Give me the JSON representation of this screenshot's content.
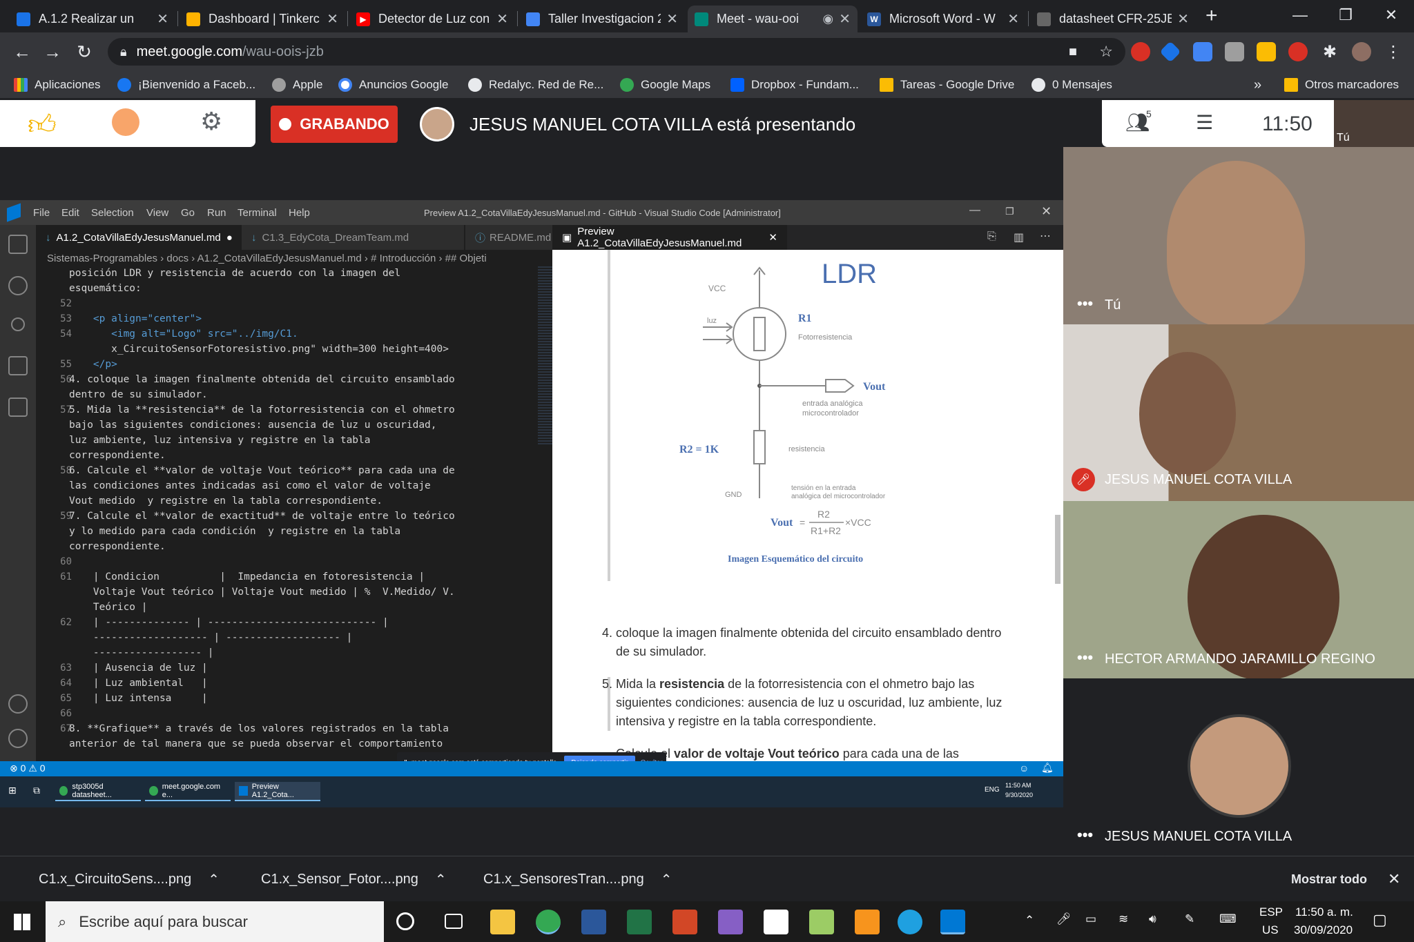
{
  "chrome": {
    "tabs": [
      {
        "title": "A.1.2 Realizar un",
        "icon": "moodle-icon",
        "color": "#1a73e8"
      },
      {
        "title": "Dashboard | Tinkerc",
        "icon": "tinkercad-icon",
        "color": "#ffb300"
      },
      {
        "title": "Detector de Luz con",
        "icon": "youtube-icon",
        "color": "#ff0000"
      },
      {
        "title": "Taller Investigacion 2",
        "icon": "docs-icon",
        "color": "#4285f4"
      },
      {
        "title": "Meet - wau-ooi",
        "icon": "meet-icon",
        "color": "#00897b"
      },
      {
        "title": "Microsoft Word - W",
        "icon": "word-icon",
        "color": "#2b579a"
      },
      {
        "title": "datasheet CFR-25JB",
        "icon": "datasheet-icon",
        "color": "#666666"
      }
    ],
    "new_tab": "+",
    "url_host": "meet.google.com",
    "url_path": "/wau-oois-jzb",
    "bookmarks": [
      {
        "label": "Aplicaciones",
        "icon": "apps-grid-icon"
      },
      {
        "label": "¡Bienvenido a Faceb...",
        "icon": "facebook-icon"
      },
      {
        "label": "Apple",
        "icon": "apple-icon"
      },
      {
        "label": "Anuncios Google",
        "icon": "google-icon"
      },
      {
        "label": "Redalyc. Red de Re...",
        "icon": "globe-icon"
      },
      {
        "label": "Google Maps",
        "icon": "maps-icon"
      },
      {
        "label": "Dropbox - Fundam...",
        "icon": "dropbox-icon"
      },
      {
        "label": "Tareas - Google Drive",
        "icon": "drive-icon"
      },
      {
        "label": "0 Mensajes",
        "icon": "globe-icon"
      }
    ],
    "bookmarks_more": "»",
    "other_bookmarks": "Otros marcadores"
  },
  "meet": {
    "recording_label": "GRABANDO",
    "presenting_text": "JESUS MANUEL COTA VILLA está presentando",
    "participants_count": "5",
    "clock": "11:50",
    "self_label": "Tú",
    "participants": [
      {
        "name": "Tú",
        "muted": false
      },
      {
        "name": "JESUS MANUEL COTA VILLA",
        "muted": true
      },
      {
        "name": "HECTOR ARMANDO JARAMILLO REGINO",
        "muted": false
      },
      {
        "name": "JESUS MANUEL COTA VILLA",
        "muted": false
      }
    ]
  },
  "vscode": {
    "menu": [
      "File",
      "Edit",
      "Selection",
      "View",
      "Go",
      "Run",
      "Terminal",
      "Help"
    ],
    "title": "Preview A1.2_CotaVillaEdyJesusManuel.md - GitHub - Visual Studio Code [Administrator]",
    "editor_tabs": [
      "A1.2_CotaVillaEdyJesusManuel.md",
      "C1.3_EdyCota_DreamTeam.md",
      "README.md"
    ],
    "preview_tab": "Preview A1.2_CotaVillaEdyJesusManuel.md",
    "breadcrumbs": "Sistemas-Programables › docs › A1.2_CotaVillaEdyJesusManuel.md › # Introducción › ## Objeti",
    "code_lines": [
      {
        "n": "",
        "t": "posición LDR y resistencia de acuerdo con la imagen del"
      },
      {
        "n": "",
        "t": "esquemático:"
      },
      {
        "n": "52",
        "t": ""
      },
      {
        "n": "53",
        "t": "    <p align=\"center\">"
      },
      {
        "n": "54",
        "t": "       <img alt=\"Logo\" src=\"../img/C1."
      },
      {
        "n": "",
        "t": "       x_CircuitoSensorFotoresistivo.png\" width=300 height=400>"
      },
      {
        "n": "55",
        "t": "    </p>"
      },
      {
        "n": "56",
        "t": "4. coloque la imagen finalmente obtenida del circuito ensamblado"
      },
      {
        "n": "",
        "t": "dentro de su simulador."
      },
      {
        "n": "57",
        "t": "5. Mida la **resistencia** de la fotorresistencia con el ohmetro"
      },
      {
        "n": "",
        "t": "bajo las siguientes condiciones: ausencia de luz u oscuridad,"
      },
      {
        "n": "",
        "t": "luz ambiente, luz intensiva y registre en la tabla"
      },
      {
        "n": "",
        "t": "correspondiente."
      },
      {
        "n": "58",
        "t": "6. Calcule el **valor de voltaje Vout teórico** para cada una de"
      },
      {
        "n": "",
        "t": "las condiciones antes indicadas asi como el valor de voltaje"
      },
      {
        "n": "",
        "t": "Vout medido  y registre en la tabla correspondiente."
      },
      {
        "n": "59",
        "t": "7. Calcule el **valor de exactitud** de voltaje entre lo teórico"
      },
      {
        "n": "",
        "t": "y lo medido para cada condición  y registre en la tabla"
      },
      {
        "n": "",
        "t": "correspondiente."
      },
      {
        "n": "60",
        "t": ""
      },
      {
        "n": "61",
        "t": "    | Condicion          |  Impedancia en fotoresistencia |"
      },
      {
        "n": "",
        "t": "    Voltaje Vout teórico | Voltaje Vout medido | %  V.Medido/ V."
      },
      {
        "n": "",
        "t": "    Teórico |"
      },
      {
        "n": "62",
        "t": "    | -------------- | ---------------------------- |"
      },
      {
        "n": "",
        "t": "    ------------------- | ------------------- |"
      },
      {
        "n": "",
        "t": "    ------------------ |"
      },
      {
        "n": "63",
        "t": "    | Ausencia de luz |"
      },
      {
        "n": "64",
        "t": "    | Luz ambiental   |"
      },
      {
        "n": "65",
        "t": "    | Luz intensa     |"
      },
      {
        "n": "66",
        "t": ""
      },
      {
        "n": "67",
        "t": "8. **Grafique** a través de los valores registrados en la tabla"
      },
      {
        "n": "",
        "t": "anterior de tal manera que se pueda observar el comportamiento"
      }
    ],
    "schematic": {
      "title": "LDR",
      "vcc": "VCC",
      "luz": "luz",
      "r1": "R1",
      "r1_desc": "Fotorresistencia",
      "vout": "Vout",
      "vout_desc1": "entrada analógica",
      "vout_desc2": "microcontrolador",
      "r2": "R2 = 1K",
      "r2_desc": "resistencia",
      "gnd": "GND",
      "gnd_desc1": "tensión en la entrada",
      "gnd_desc2": "analógica del microcontrolador",
      "formula_left": "Vout",
      "formula_num": "R2",
      "formula_den": "R1+R2",
      "formula_tail": "×VCC",
      "caption": "Imagen  Esquemático del circuito"
    },
    "preview_items": [
      {
        "num": "4.",
        "pre": "coloque la imagen finalmente obtenida del circuito ensamblado dentro de su simulador.",
        "bold": "",
        "post": ""
      },
      {
        "num": "5.",
        "pre": "Mida la ",
        "bold": "resistencia",
        "post": " de la fotorresistencia con el ohmetro bajo las siguientes condiciones: ausencia de luz u oscuridad, luz ambiente, luz intensiva y registre en la tabla correspondiente."
      },
      {
        "num": "6.",
        "pre": "Calcule el ",
        "bold": "valor de voltaje Vout teórico",
        "post": " para cada una de las condiciones antes indicadas asi como el valor de voltaje Vout"
      }
    ],
    "status_left": "⊗ 0 ⚠ 0",
    "share_notice": "meet.google.com está compartiendo tu pantalla.",
    "share_stop": "Dejar de compartir",
    "share_hide": "Ocultar",
    "inner_taskbar": [
      "stp3005d datasheet...",
      "meet.google.com e...",
      "Preview A1.2_Cota..."
    ],
    "inner_tray_lang": "ENG",
    "inner_time": "11:50 AM",
    "inner_date": "9/30/2020"
  },
  "downloads": {
    "files": [
      "C1.x_CircuitoSens....png",
      "C1.x_Sensor_Fotor....png",
      "C1.x_SensoresTran....png"
    ],
    "show_all": "Mostrar todo"
  },
  "windows": {
    "search_placeholder": "Escribe aquí para buscar",
    "lang": "ESP",
    "lang2": "US",
    "time": "11:50 a. m.",
    "date": "30/09/2020"
  }
}
